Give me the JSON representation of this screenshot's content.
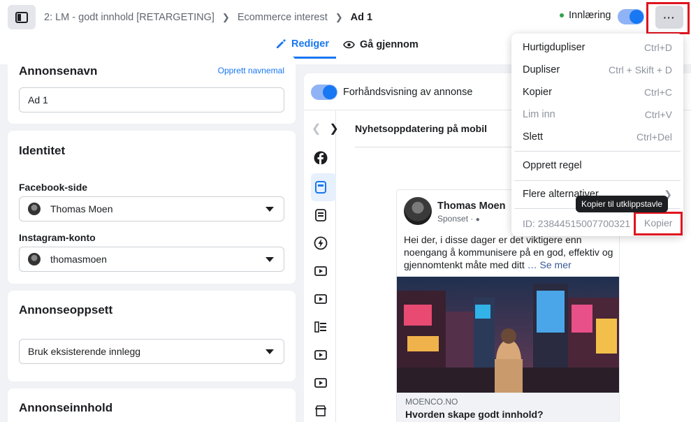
{
  "breadcrumb": {
    "campaign": "2: LM - godt innhold [RETARGETING]",
    "adset": "Ecommerce interest",
    "ad": "Ad 1"
  },
  "status": {
    "label": "Innlæring",
    "dot_color": "#31a24c"
  },
  "more_button": {
    "label": "···"
  },
  "tabs": [
    {
      "label": "Rediger",
      "icon": "pencil-icon",
      "active": true
    },
    {
      "label": "Gå gjennom",
      "icon": "eye-icon",
      "active": false
    }
  ],
  "ad_name": {
    "title": "Annonsenavn",
    "create_link": "Opprett navnemal",
    "value": "Ad 1"
  },
  "identity": {
    "title": "Identitet",
    "facebook_label": "Facebook-side",
    "facebook_value": "Thomas Moen",
    "instagram_label": "Instagram-konto",
    "instagram_value": "thomasmoen"
  },
  "ad_setup": {
    "title": "Annonseoppsett",
    "value": "Bruk eksisterende innlegg"
  },
  "ad_content": {
    "title": "Annonseinnhold"
  },
  "preview": {
    "toggle_label": "Forhåndsvisning av annonse",
    "placement_title": "Nyhetsoppdatering på mobil",
    "placement_icons": [
      "facebook-icon",
      "feed-icon",
      "stories-icon",
      "lightning-icon",
      "video-icon",
      "video-icon",
      "list-icon",
      "video-icon",
      "video-icon",
      "marketplace-icon"
    ]
  },
  "post": {
    "name": "Thomas Moen",
    "sponsored": "Sponset ·",
    "text": "Hei der, i disse dager er det viktigere enn noengang å kommunisere på en god, effektiv og gjennomtenkt måte med ditt",
    "see_more": "… Se mer",
    "domain": "MOENCO.NO",
    "headline": "Hvorden skape godt innhold?"
  },
  "menu": {
    "items": [
      {
        "label": "Hurtigdupliser",
        "shortcut": "Ctrl+D"
      },
      {
        "label": "Dupliser",
        "shortcut": "Ctrl + Skift + D"
      },
      {
        "label": "Kopier",
        "shortcut": "Ctrl+C"
      },
      {
        "label": "Lim inn",
        "shortcut": "Ctrl+V",
        "disabled": true
      },
      {
        "label": "Slett",
        "shortcut": "Ctrl+Del"
      },
      {
        "label": "Opprett regel",
        "shortcut": ""
      },
      {
        "label": "Flere alternativer",
        "shortcut": ""
      }
    ],
    "id_text": "ID: 23844515007700321",
    "copy_label": "Kopier",
    "tooltip": "Kopier til utklippstavle"
  },
  "colors": {
    "accent": "#1877f2",
    "highlight": "#e0141e"
  }
}
